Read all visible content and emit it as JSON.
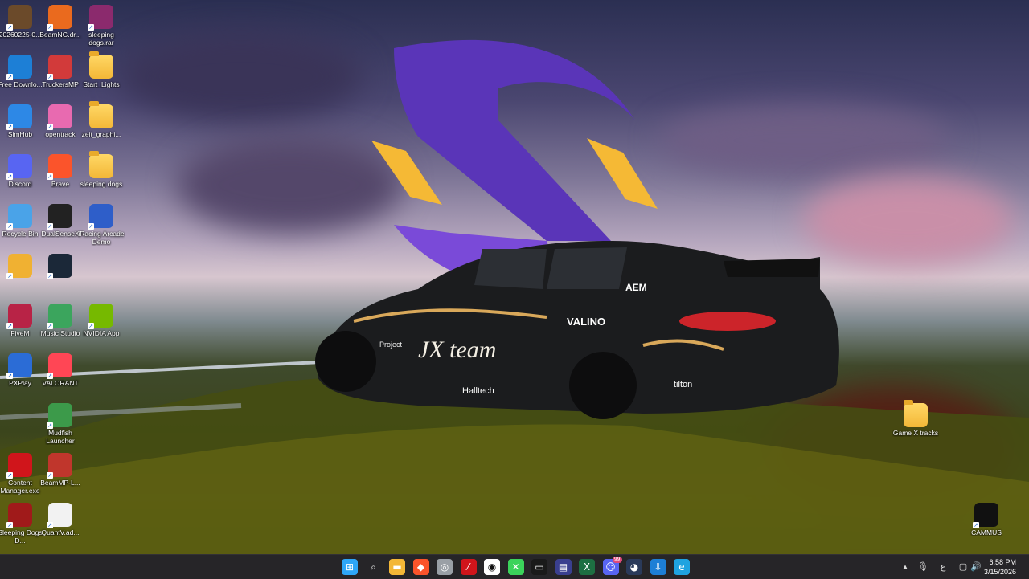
{
  "desktop": {
    "icons": [
      {
        "label": "20260225-0...",
        "icon": "video-thumbnail-icon",
        "color": "#6b4a2a"
      },
      {
        "label": "BeamNG.dr...",
        "icon": "beamng-icon",
        "color": "#ea6a1e"
      },
      {
        "label": "sleeping dogs.rar",
        "icon": "winrar-archive-icon",
        "color": "#8b2a6d"
      },
      {
        "label": "Free Downlo...",
        "icon": "download-manager-icon",
        "color": "#1d7fd6"
      },
      {
        "label": "TruckersMP",
        "icon": "truckersmp-icon",
        "color": "#d23a3a"
      },
      {
        "label": "Start_Lights",
        "icon": "folder-icon",
        "color": "#f3b737"
      },
      {
        "label": "SimHub",
        "icon": "simhub-icon",
        "color": "#2d88e6"
      },
      {
        "label": "opentrack",
        "icon": "opentrack-icon",
        "color": "#e86ab0"
      },
      {
        "label": "zeit_graphi...",
        "icon": "folder-icon",
        "color": "#f3b737"
      },
      {
        "label": "Discord",
        "icon": "discord-icon",
        "color": "#5865f2"
      },
      {
        "label": "Brave",
        "icon": "brave-icon",
        "color": "#fb542b"
      },
      {
        "label": "sleeping dogs",
        "icon": "folder-icon",
        "color": "#f3b737"
      },
      {
        "label": "Recycle Bin",
        "icon": "recycle-bin-icon",
        "color": "#4aa3e8"
      },
      {
        "label": "DualSenseX",
        "icon": "dualsensex-icon",
        "color": "#222222"
      },
      {
        "label": "iRacing Arcade Demo",
        "icon": "iracing-icon",
        "color": "#2e5ec9"
      },
      {
        "label": "",
        "icon": "discord-canary-icon",
        "color": "#f0b132"
      },
      {
        "label": "",
        "icon": "steam-icon",
        "color": "#1b2838"
      },
      {
        "label": "FiveM",
        "icon": "fivem-icon",
        "color": "#b82346"
      },
      {
        "label": "Music Studio",
        "icon": "music-studio-icon",
        "color": "#3ba55d"
      },
      {
        "label": "NVIDIA App",
        "icon": "nvidia-icon",
        "color": "#76b900"
      },
      {
        "label": "PXPlay",
        "icon": "pxplay-icon",
        "color": "#2b6cd6"
      },
      {
        "label": "VALORANT",
        "icon": "valorant-icon",
        "color": "#ff4655"
      },
      {
        "label": "Mudfish Launcher",
        "icon": "mudfish-icon",
        "color": "#3c9a4a"
      },
      {
        "label": "Content Manager.exe",
        "icon": "content-manager-icon",
        "color": "#d0151b"
      },
      {
        "label": "BeamMP-L...",
        "icon": "beammp-icon",
        "color": "#c0362c"
      },
      {
        "label": "Sleeping Dogs D...",
        "icon": "sleeping-dogs-icon",
        "color": "#a01a1a"
      },
      {
        "label": "QuantV.ad...",
        "icon": "document-file-icon",
        "color": "#f2f2f2"
      },
      {
        "label": "Game X tracks",
        "icon": "folder-icon",
        "color": "#f3b737"
      },
      {
        "label": "CAMMUS",
        "icon": "cammus-icon",
        "color": "#111111"
      }
    ],
    "wallpaper": {
      "car_text": [
        "JX team",
        "Project",
        "AEM",
        "Halltech",
        "tilton",
        "VALINO"
      ],
      "accent_purple": "#6a3fc4",
      "accent_gold": "#f5b935"
    }
  },
  "taskbar": {
    "apps": [
      {
        "name": "start-button",
        "icon": "windows-logo-icon",
        "color": "#2ea6f7"
      },
      {
        "name": "search-button",
        "icon": "search-icon",
        "color": "#ffffff"
      },
      {
        "name": "file-explorer",
        "icon": "folder-icon",
        "color": "#f3b737"
      },
      {
        "name": "brave-browser",
        "icon": "brave-icon",
        "color": "#fb542b"
      },
      {
        "name": "steam-overlay",
        "icon": "steam-circle-icon",
        "color": "#9aa0a6"
      },
      {
        "name": "content-manager",
        "icon": "content-manager-icon",
        "color": "#d0151b"
      },
      {
        "name": "obs-studio",
        "icon": "obs-icon",
        "color": "#ffffff"
      },
      {
        "name": "xbox-app",
        "icon": "xbox-icon",
        "color": "#3bd35b"
      },
      {
        "name": "game-window",
        "icon": "app-window-icon",
        "color": "#1a1a1a"
      },
      {
        "name": "capture-app",
        "icon": "capture-icon",
        "color": "#3a3f8f"
      },
      {
        "name": "excel-app",
        "icon": "excel-icon",
        "color": "#1d6f42"
      },
      {
        "name": "discord-app",
        "icon": "discord-icon",
        "color": "#5865f2",
        "badge": "99"
      },
      {
        "name": "steam-app",
        "icon": "steam-icon",
        "color": "#2a3a5a"
      },
      {
        "name": "download-manager",
        "icon": "download-manager-icon",
        "color": "#1d7fd6"
      },
      {
        "name": "edge-browser",
        "icon": "edge-icon",
        "color": "#1fa3e0"
      }
    ],
    "tray": {
      "icons": [
        "chevron-up-icon",
        "microphone-icon",
        "keyboard-layout-icon",
        "notification-icon",
        "speaker-icon",
        "battery-icon"
      ],
      "layout_label": "ع",
      "time": "6:58 PM",
      "date": "3/15/2026"
    }
  }
}
